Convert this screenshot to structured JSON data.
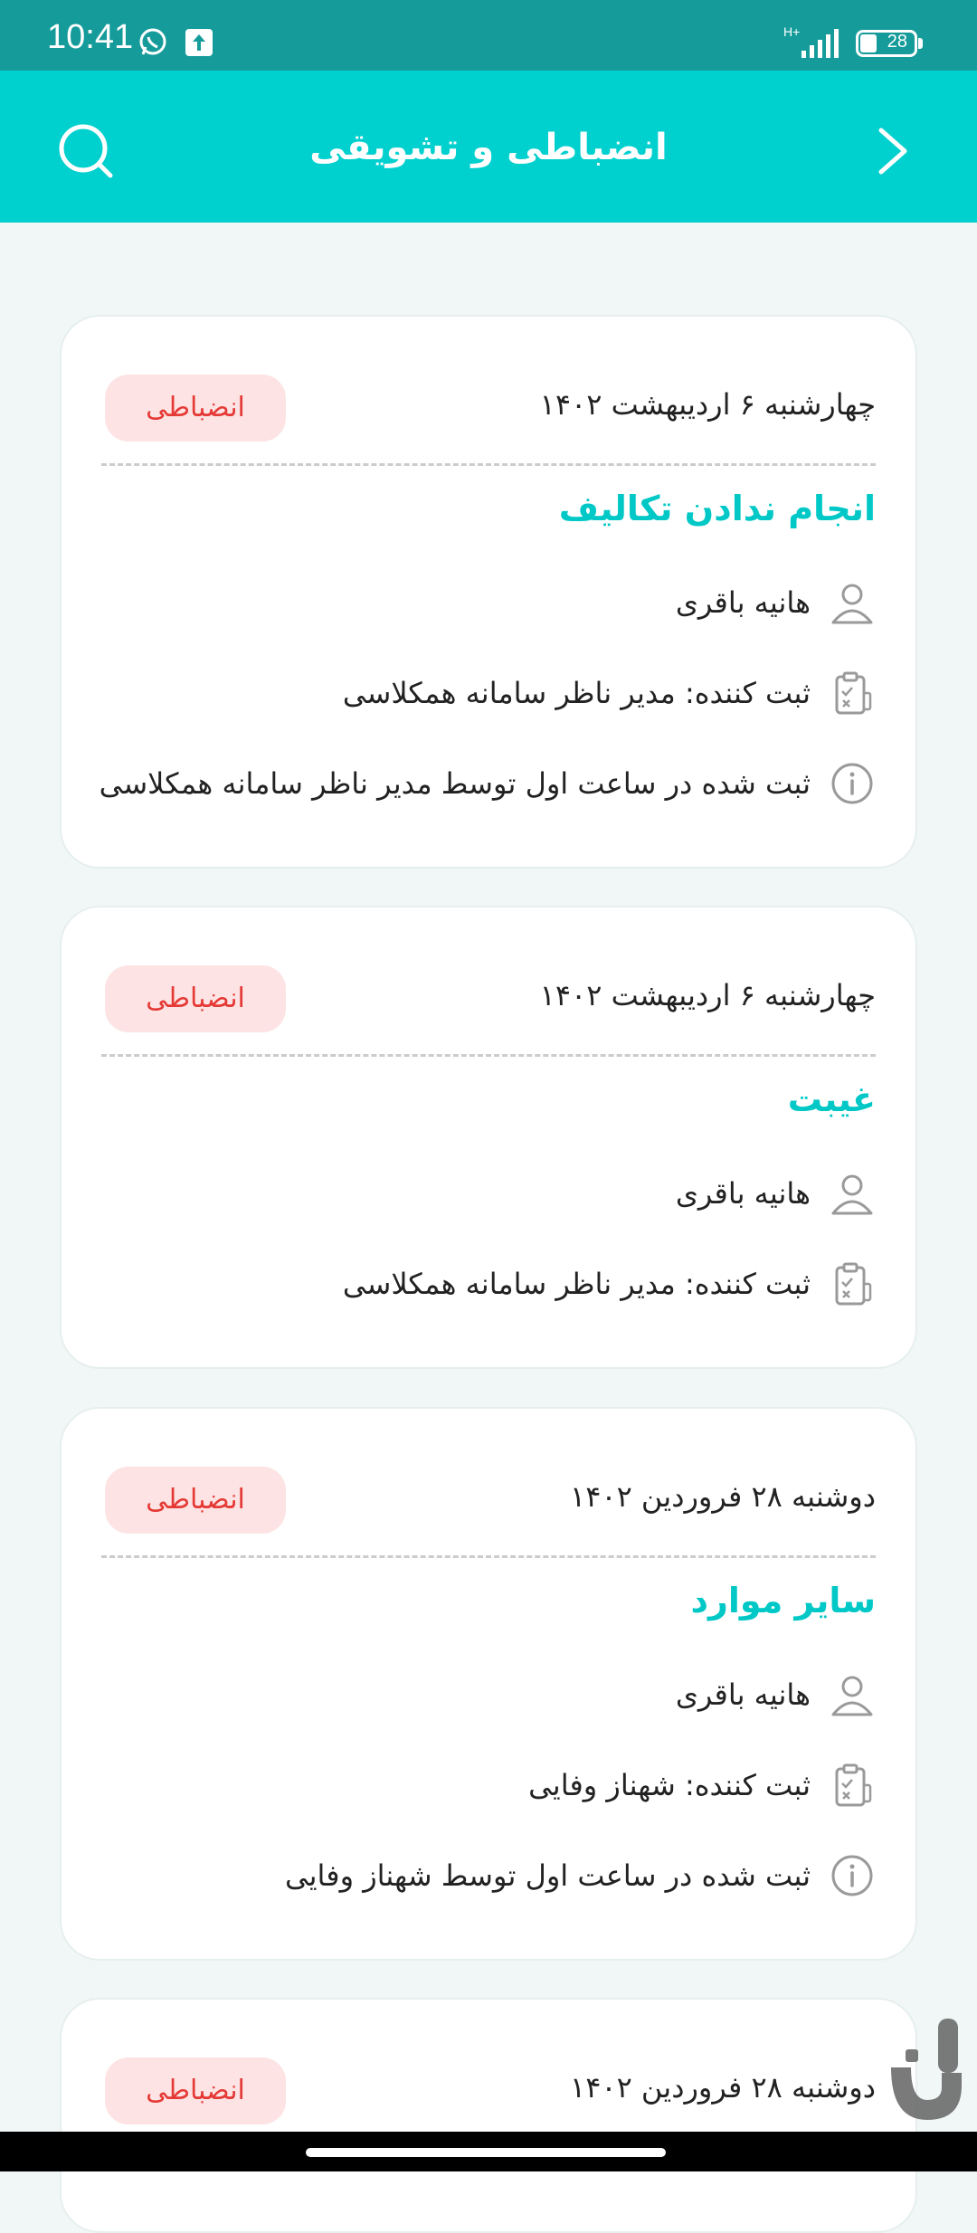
{
  "status_bar": {
    "time": "10:41",
    "battery": "28",
    "network": "H+"
  },
  "header": {
    "title": "انضباطی و تشویقی"
  },
  "colors": {
    "header_bg": "#00d0ce",
    "status_bg": "#169b9b",
    "accent_title": "#00c8c6",
    "badge_bg": "#fde3e3",
    "badge_text": "#e53935"
  },
  "cards": [
    {
      "date": "چهارشنبه ۶ اردیبهشت ۱۴۰۲",
      "badge": "انضباطی",
      "title": "انجام ندادن تکالیف",
      "student": "هانیه باقری",
      "recorder": "ثبت کننده: مدیر ناظر سامانه همکلاسی",
      "note": "ثبت شده در ساعت اول توسط مدیر ناظر سامانه همکلاسی"
    },
    {
      "date": "چهارشنبه ۶ اردیبهشت ۱۴۰۲",
      "badge": "انضباطی",
      "title": "غیبت",
      "student": "هانیه باقری",
      "recorder": "ثبت کننده: مدیر ناظر سامانه همکلاسی"
    },
    {
      "date": "دوشنبه ۲۸ فروردین ۱۴۰۲",
      "badge": "انضباطی",
      "title": "سایر موارد",
      "student": "هانیه باقری",
      "recorder": "ثبت کننده: شهناز وفایی",
      "note": "ثبت شده در ساعت اول توسط شهناز وفایی"
    },
    {
      "date": "دوشنبه ۲۸ فروردین ۱۴۰۲",
      "badge": "انضباطی"
    }
  ]
}
